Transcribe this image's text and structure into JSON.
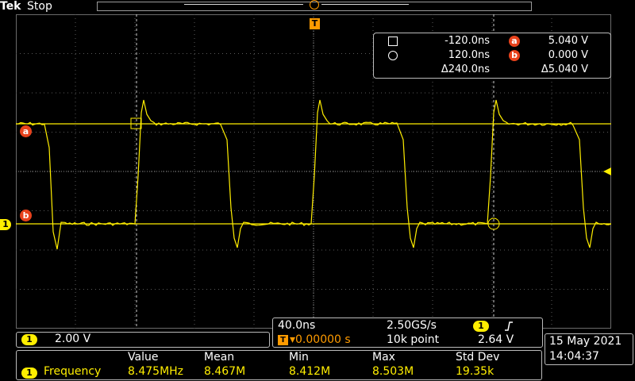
{
  "header": {
    "brand": "Tek",
    "state": "Stop"
  },
  "markers": {
    "trigger_tag": "T",
    "ch1_tag": "1",
    "cursor_a_tag": "a",
    "cursor_b_tag": "b"
  },
  "cursors": {
    "row1": {
      "time": "-120.0ns",
      "letter": "a",
      "volt": "5.040 V"
    },
    "row2": {
      "time": "120.0ns",
      "letter": "b",
      "volt": "0.000 V"
    },
    "row3": {
      "time": "Δ240.0ns",
      "volt": "Δ5.040 V"
    }
  },
  "vertical": {
    "channel": "1",
    "scale": "2.00 V"
  },
  "horizontal": {
    "timebase": "40.0ns",
    "sample_rate": "2.50GS/s",
    "trigger_tag": "T",
    "position": "▾0.00000 s",
    "record": "10k point",
    "trig_channel": "1",
    "trig_level": "2.64 V"
  },
  "datetime": {
    "date": "15 May 2021",
    "time": "14:04:37"
  },
  "measurements": {
    "headers": [
      "Value",
      "Mean",
      "Min",
      "Max",
      "Std Dev"
    ],
    "channel": "1",
    "name": "Frequency",
    "values": [
      "8.475MHz",
      "8.467M",
      "8.412M",
      "8.503M",
      "19.35k"
    ]
  },
  "colors": {
    "trace": "#ffee00",
    "accent": "#ff9b00",
    "cursor_label": "#e8421c"
  }
}
